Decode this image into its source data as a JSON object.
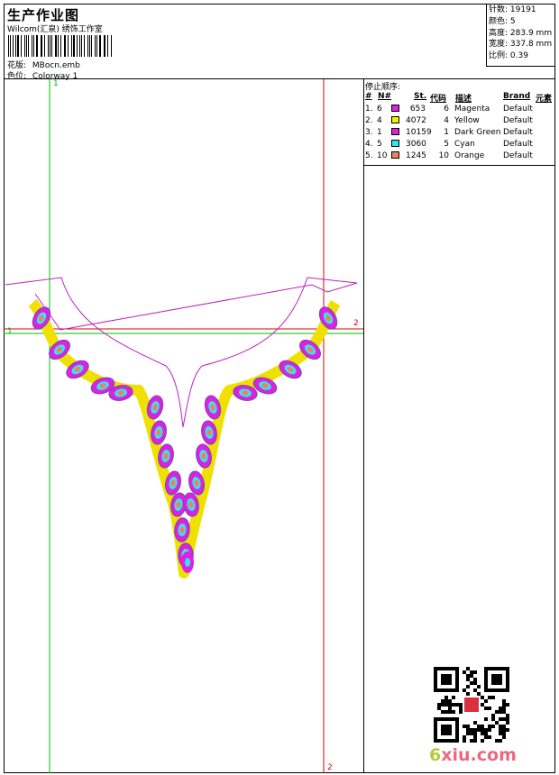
{
  "header": {
    "title": "生产作业图",
    "subtitle": "Wilcom(汇泉) 绣饰工作室",
    "pattern_label": "花版:",
    "pattern_value": "MBocn.emb",
    "colorway_label": "色位:",
    "colorway_value": "Colorway 1"
  },
  "stats": [
    {
      "label": "针数:",
      "value": "19191"
    },
    {
      "label": "颜色:",
      "value": "5"
    },
    {
      "label": "高度:",
      "value": "283.9 mm"
    },
    {
      "label": "宽度:",
      "value": "337.8 mm"
    },
    {
      "label": "比例:",
      "value": "0.39"
    }
  ],
  "stop_sequence": {
    "title": "停止顺序:",
    "columns": [
      "#",
      "N#",
      "St.",
      "代码",
      "描述",
      "Brand",
      "元素"
    ],
    "rows": [
      {
        "idx": "1.",
        "n": "6",
        "color": "#e020e0",
        "st": "653",
        "code": "6",
        "desc": "Magenta",
        "brand": "Default"
      },
      {
        "idx": "2.",
        "n": "4",
        "color": "#f0f000",
        "st": "4072",
        "code": "4",
        "desc": "Yellow",
        "brand": "Default"
      },
      {
        "idx": "3.",
        "n": "1",
        "color": "#e020e0",
        "st": "10159",
        "code": "1",
        "desc": "Dark Green",
        "brand": "Default"
      },
      {
        "idx": "4.",
        "n": "5",
        "color": "#30e8e8",
        "st": "3060",
        "code": "5",
        "desc": "Cyan",
        "brand": "Default"
      },
      {
        "idx": "5.",
        "n": "10",
        "color": "#f08060",
        "st": "1245",
        "code": "10",
        "desc": "Orange",
        "brand": "Default"
      }
    ]
  },
  "guides": {
    "v1_top": "1",
    "h1_left": "1",
    "h2_right": "2",
    "v2_bottom": "2"
  },
  "watermark": {
    "num": "6",
    "rest": "xiu.com"
  },
  "colors": {
    "magenta": "#e020e0",
    "yellow": "#f0f000",
    "cyan": "#30e8e8",
    "orange": "#f08060",
    "purple": "#9040c0",
    "guide_green": "#00c000",
    "guide_red": "#e00000"
  }
}
